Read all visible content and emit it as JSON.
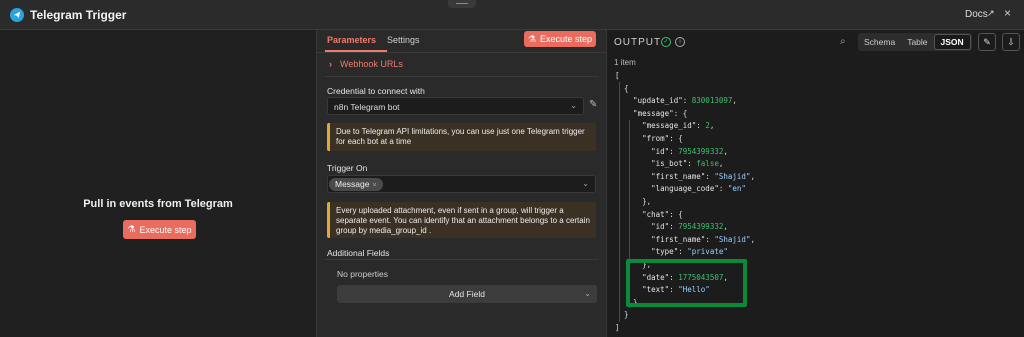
{
  "window": {
    "title": "Telegram Trigger",
    "docs": "Docs",
    "close": "×",
    "external": "↗"
  },
  "left": {
    "title": "Pull in events from Telegram",
    "exec": "Execute step"
  },
  "params": {
    "tabs": [
      "Parameters",
      "Settings"
    ],
    "exec": "Execute step",
    "webhook": "Webhook URLs",
    "credential_label": "Credential to connect with",
    "credential_value": "n8n Telegram bot",
    "note1": "Due to Telegram API limitations, you can use just one Telegram trigger for each bot at a time",
    "trigger_label": "Trigger On",
    "trigger_chip": "Message",
    "note2": "Every uploaded attachment, even if sent in a group, will trigger a separate event. You can identify that an attachment belongs to a certain group by media_group_id .",
    "additional_label": "Additional Fields",
    "no_props": "No properties",
    "add_field": "Add Field"
  },
  "output": {
    "title": "OUTPUT",
    "items": "1 item",
    "views": [
      "Schema",
      "Table",
      "JSON"
    ],
    "active_view": "JSON"
  },
  "json_lines": [
    {
      "t": "["
    },
    {
      "t": "  {"
    },
    {
      "k": "    \"update_id\"",
      "v": "830013097",
      "vt": "n",
      "end": ","
    },
    {
      "k": "    \"message\"",
      "v": "{",
      "vt": "p"
    },
    {
      "k": "      \"message_id\"",
      "v": "2",
      "vt": "n",
      "end": ","
    },
    {
      "k": "      \"from\"",
      "v": "{",
      "vt": "p"
    },
    {
      "k": "        \"id\"",
      "v": "7954399332",
      "vt": "n",
      "end": ","
    },
    {
      "k": "        \"is_bot\"",
      "v": "false",
      "vt": "n",
      "end": ","
    },
    {
      "k": "        \"first_name\"",
      "v": "\"Shajid\"",
      "vt": "s",
      "end": ","
    },
    {
      "k": "        \"language_code\"",
      "v": "\"en\"",
      "vt": "s"
    },
    {
      "t": "      },"
    },
    {
      "k": "      \"chat\"",
      "v": "{",
      "vt": "p"
    },
    {
      "k": "        \"id\"",
      "v": "7954399332",
      "vt": "n",
      "end": ","
    },
    {
      "k": "        \"first_name\"",
      "v": "\"Shajid\"",
      "vt": "s",
      "end": ","
    },
    {
      "k": "        \"type\"",
      "v": "\"private\"",
      "vt": "s"
    },
    {
      "t": "      },"
    },
    {
      "k": "      \"date\"",
      "v": "1775043507",
      "vt": "n",
      "end": ","
    },
    {
      "k": "      \"text\"",
      "v": "\"Hello\"",
      "vt": "s"
    },
    {
      "t": "    }"
    },
    {
      "t": "  }"
    },
    {
      "t": "]"
    }
  ]
}
